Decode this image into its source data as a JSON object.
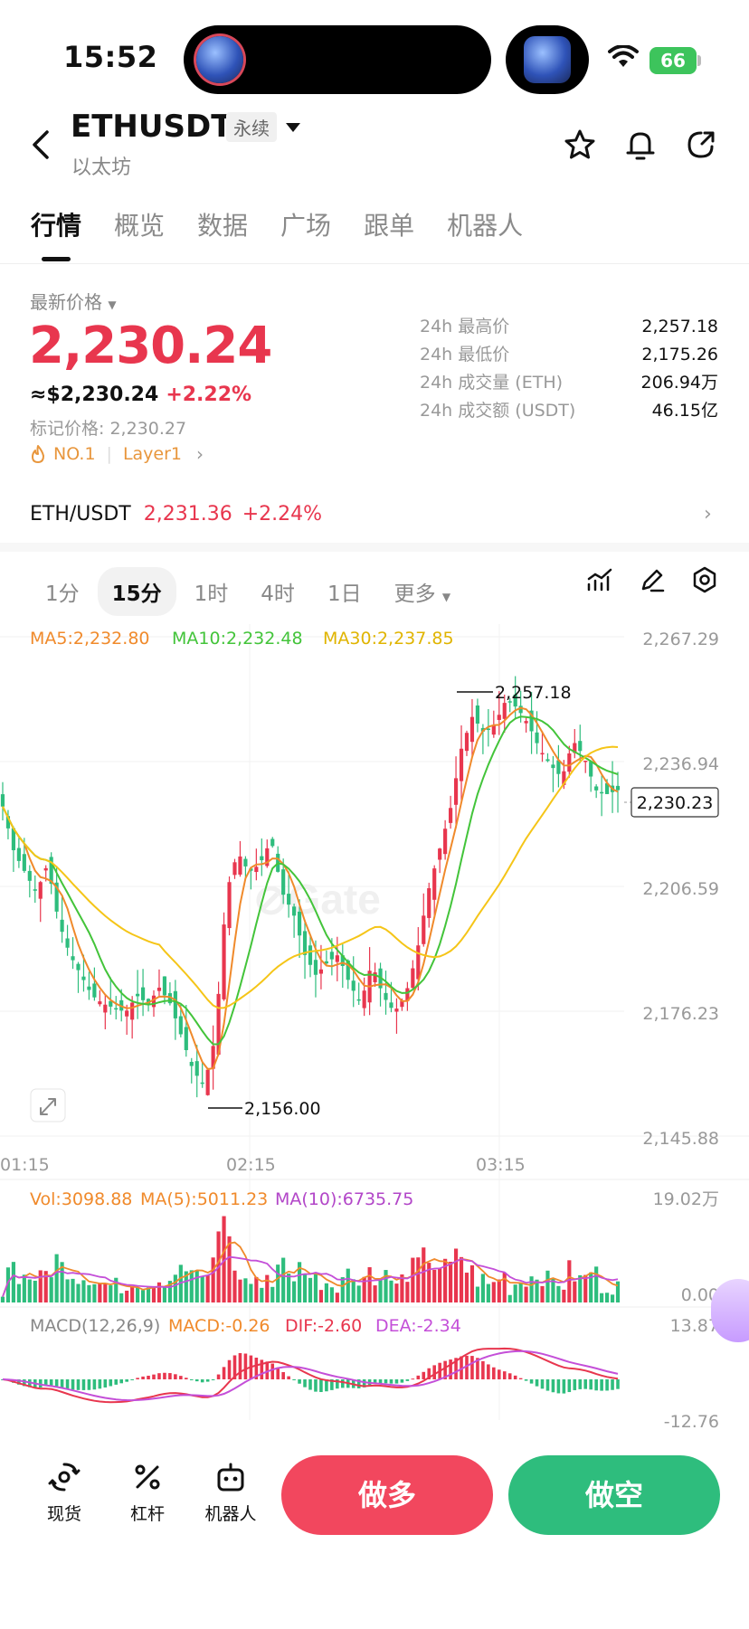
{
  "status": {
    "time": "15:52",
    "battery": "66"
  },
  "header": {
    "symbol": "ETHUSDT",
    "contract_tag": "永续",
    "subtitle": "以太坊"
  },
  "tabs": [
    "行情",
    "概览",
    "数据",
    "广场",
    "跟单",
    "机器人"
  ],
  "price_panel": {
    "latest_label": "最新价格",
    "last_price": "2,230.24",
    "usd_price": "≈$2,230.24",
    "change": "+2.22%",
    "mark_price": "标记价格: 2,230.27",
    "rank_tag": "NO.1",
    "sector_tag": "Layer1"
  },
  "stats": [
    {
      "label": "24h 最高价",
      "value": "2,257.18"
    },
    {
      "label": "24h 最低价",
      "value": "2,175.26"
    },
    {
      "label": "24h 成交量 (ETH)",
      "value": "206.94万"
    },
    {
      "label": "24h 成交额 (USDT)",
      "value": "46.15亿"
    }
  ],
  "spot": {
    "pair": "ETH/USDT",
    "price": "2,231.36",
    "change": "+2.24%"
  },
  "intervals": [
    "1分",
    "15分",
    "1时",
    "4时",
    "1日",
    "更多"
  ],
  "ma_legend": {
    "ma5": "MA5:2,232.80",
    "ma10": "MA10:2,232.48",
    "ma30": "MA30:2,237.85"
  },
  "vol_legend": {
    "vol": "Vol:3098.88",
    "ma5": "MA(5):5011.23",
    "ma10": "MA(10):6735.75"
  },
  "macd_legend": {
    "name": "MACD(12,26,9)",
    "macd": "MACD:-0.26",
    "dif": "DIF:-2.60",
    "dea": "DEA:-2.34"
  },
  "colors": {
    "up": "#e8364e",
    "down": "#2ebd7d",
    "ma5": "#f08a2b",
    "ma10": "#43c43a",
    "ma30": "#f5c518",
    "dea": "#c44fd8"
  },
  "chart_data": {
    "type": "candlestick",
    "price_axis": [
      "2,267.29",
      "2,236.94",
      "2,206.59",
      "2,176.23",
      "2,145.88"
    ],
    "ylim": [
      2145.88,
      2267.29
    ],
    "time_axis": [
      "01:15",
      "02:15",
      "03:15"
    ],
    "high_label": "2,257.18",
    "low_label": "2,156.00",
    "current_label": "2,230.23",
    "volume_axis": [
      "19.02万",
      "0.00"
    ],
    "macd_axis": [
      "13.87",
      "-12.76"
    ],
    "close_path": [
      2226,
      2215,
      2210,
      2205,
      2212,
      2198,
      2190,
      2185,
      2180,
      2178,
      2177,
      2176,
      2180,
      2178,
      2182,
      2178,
      2170,
      2162,
      2158,
      2170,
      2205,
      2215,
      2210,
      2212,
      2218,
      2205,
      2200,
      2190,
      2185,
      2188,
      2190,
      2183,
      2178,
      2188,
      2180,
      2176,
      2180,
      2190,
      2205,
      2215,
      2225,
      2240,
      2248,
      2244,
      2246,
      2252,
      2250,
      2246,
      2240,
      2236,
      2233,
      2242,
      2238,
      2230,
      2229,
      2230
    ]
  }
}
